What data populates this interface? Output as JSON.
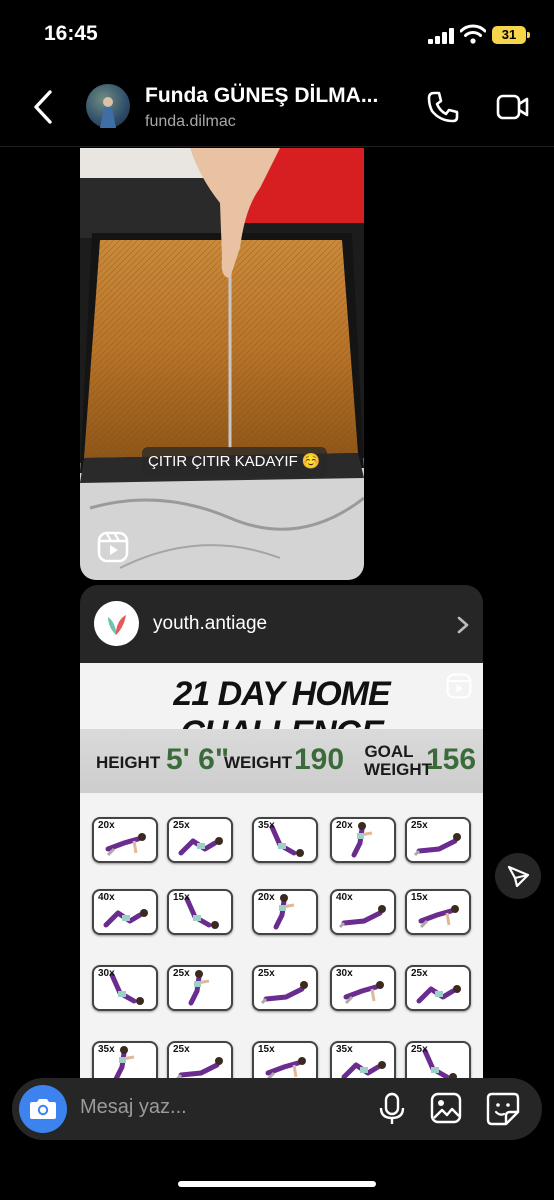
{
  "status_bar": {
    "time": "16:45",
    "battery": "31"
  },
  "header": {
    "name": "Funda GÜNEŞ DİLMA...",
    "username": "funda.dilmac"
  },
  "messages": [
    {
      "type": "reel",
      "caption": "ÇITIR ÇITIR KADAYIF ☺️"
    },
    {
      "type": "shared_post",
      "account": "youth.antiage",
      "poster": {
        "title": "21 DAY HOME CHALLENGE",
        "height_label": "HEIGHT",
        "height_value": "5' 6\"",
        "weight_label": "WEIGHT",
        "weight_value": "190",
        "goal_label_1": "GOAL",
        "goal_label_2": "WEIGHT",
        "goal_value": "156",
        "rows": [
          [
            "20x",
            "25x",
            "35x",
            "20x",
            "25x"
          ],
          [
            "40x",
            "15x",
            "20x",
            "40x",
            "15x"
          ],
          [
            "30x",
            "25x",
            "25x",
            "30x",
            "25x"
          ],
          [
            "35x",
            "25x",
            "15x",
            "35x",
            "25x"
          ]
        ]
      }
    }
  ],
  "composer": {
    "placeholder": "Mesaj yaz..."
  },
  "colors": {
    "accent": "#3c83f0",
    "poster_green": "#3b6b3a",
    "exercise_purple": "#6a2c8e"
  }
}
